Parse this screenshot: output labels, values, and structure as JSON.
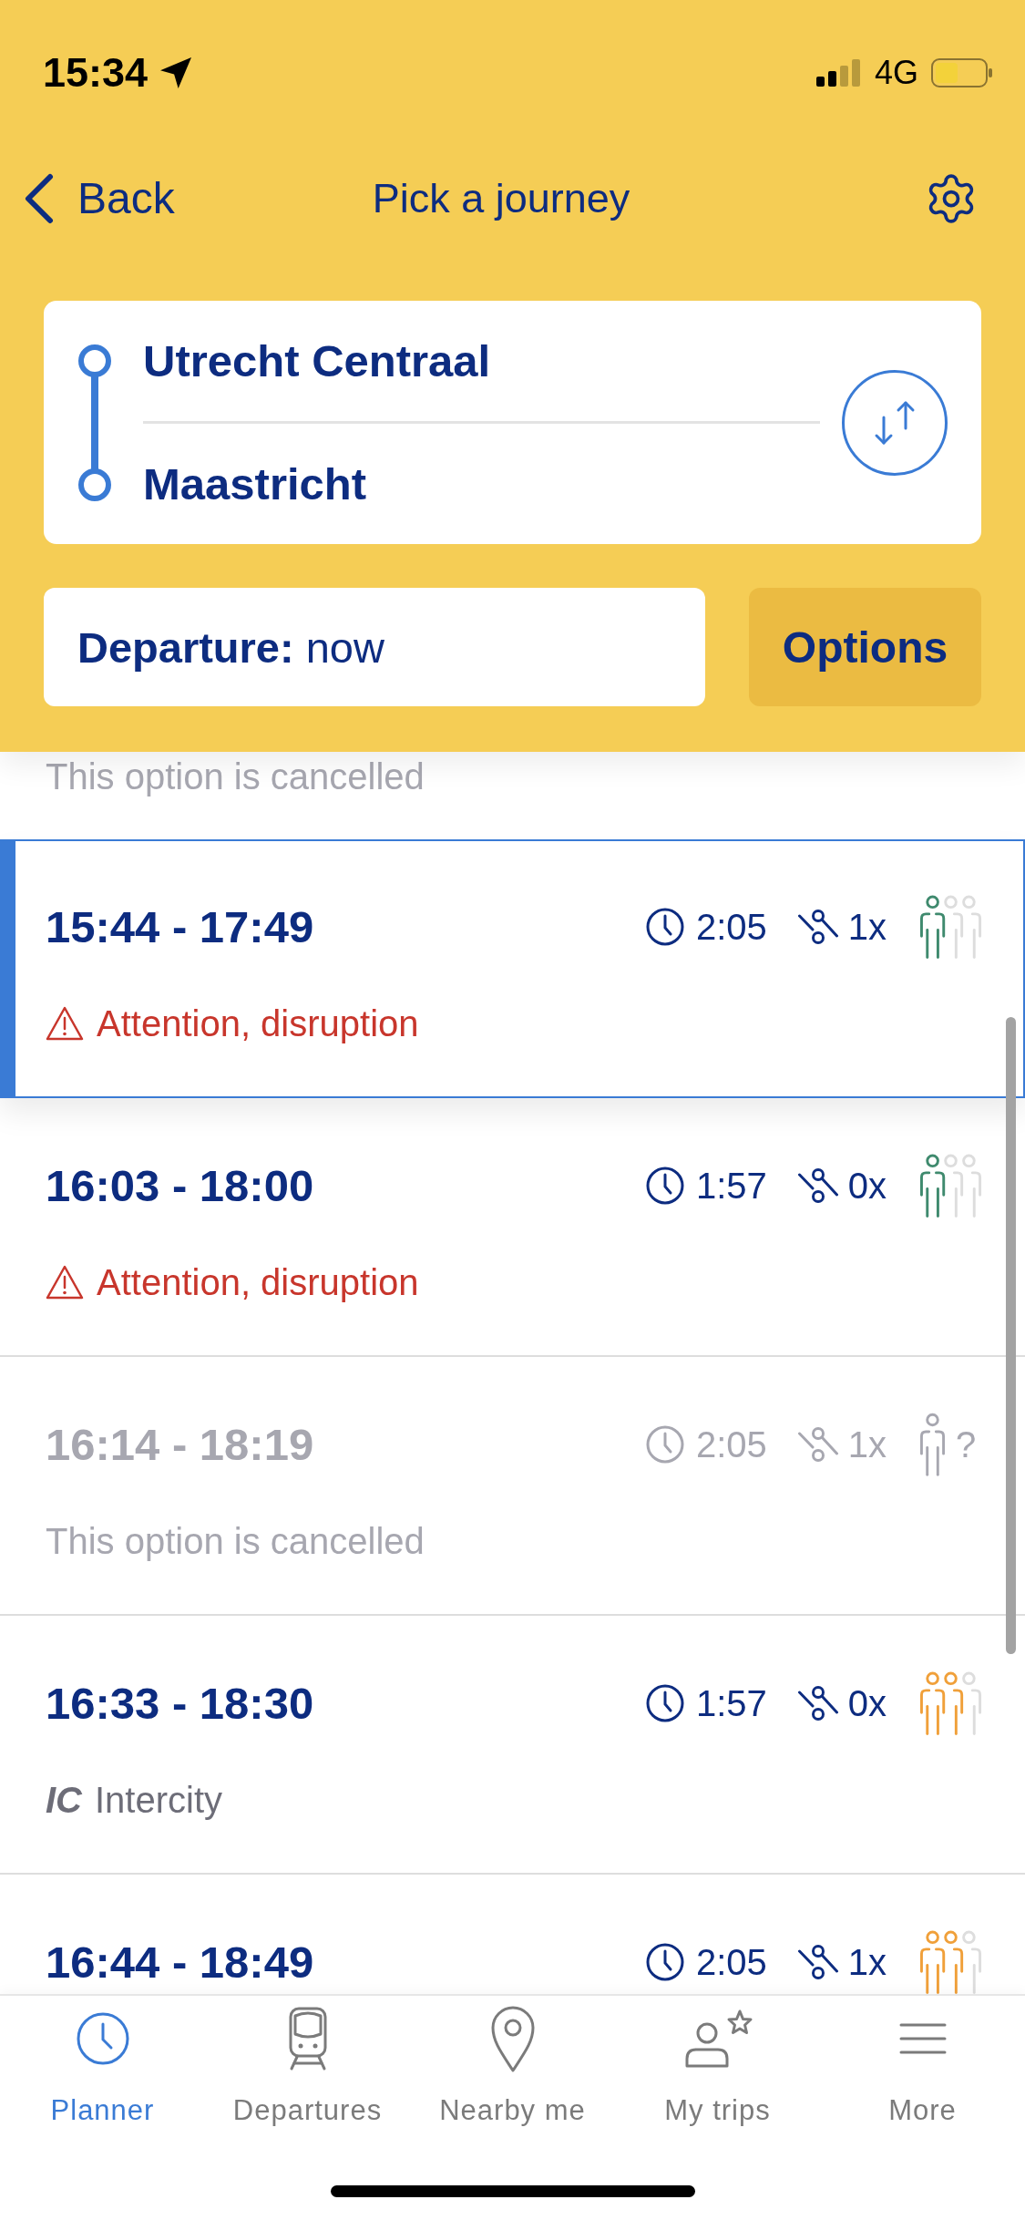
{
  "status_bar": {
    "time": "15:34",
    "network": "4G"
  },
  "nav_bar": {
    "back_label": "Back",
    "title": "Pick a journey"
  },
  "route": {
    "from": "Utrecht Centraal",
    "to": "Maastricht"
  },
  "departure": {
    "text": "**Departure:** now"
  },
  "options_button": {
    "label": "Options"
  },
  "clipped_journey": {
    "message": {
      "kind": "cancelled",
      "text": "This option is cancelled"
    }
  },
  "journeys": [
    {
      "times": "15:44 - 17:49",
      "duration": "2:05",
      "transfers": "1x",
      "crowding": {
        "kind": "low"
      },
      "selected": true,
      "cancelled": false,
      "message": {
        "kind": "disruption",
        "text": "Attention, disruption"
      }
    },
    {
      "times": "16:03 - 18:00",
      "duration": "1:57",
      "transfers": "0x",
      "crowding": {
        "kind": "low"
      },
      "selected": false,
      "cancelled": false,
      "message": {
        "kind": "disruption",
        "text": "Attention, disruption"
      }
    },
    {
      "times": "16:14 - 18:19",
      "duration": "2:05",
      "transfers": "1x",
      "crowding": {
        "kind": "unknown",
        "label": "?"
      },
      "selected": false,
      "cancelled": true,
      "message": {
        "kind": "cancelled",
        "text": "This option is cancelled"
      }
    },
    {
      "times": "16:33 - 18:30",
      "duration": "1:57",
      "transfers": "0x",
      "crowding": {
        "kind": "medium"
      },
      "selected": false,
      "cancelled": false,
      "message": {
        "kind": "train_type",
        "code": "IC",
        "text": "Intercity"
      }
    },
    {
      "times": "16:44 - 18:49",
      "duration": "2:05",
      "transfers": "1x",
      "crowding": {
        "kind": "medium"
      },
      "selected": false,
      "cancelled": false
    }
  ],
  "tab_bar": [
    {
      "label": "Planner",
      "selected": true
    },
    {
      "label": "Departures",
      "selected": false
    },
    {
      "label": "Nearby me",
      "selected": false
    },
    {
      "label": "My trips",
      "selected": false
    },
    {
      "label": "More",
      "selected": false
    }
  ]
}
